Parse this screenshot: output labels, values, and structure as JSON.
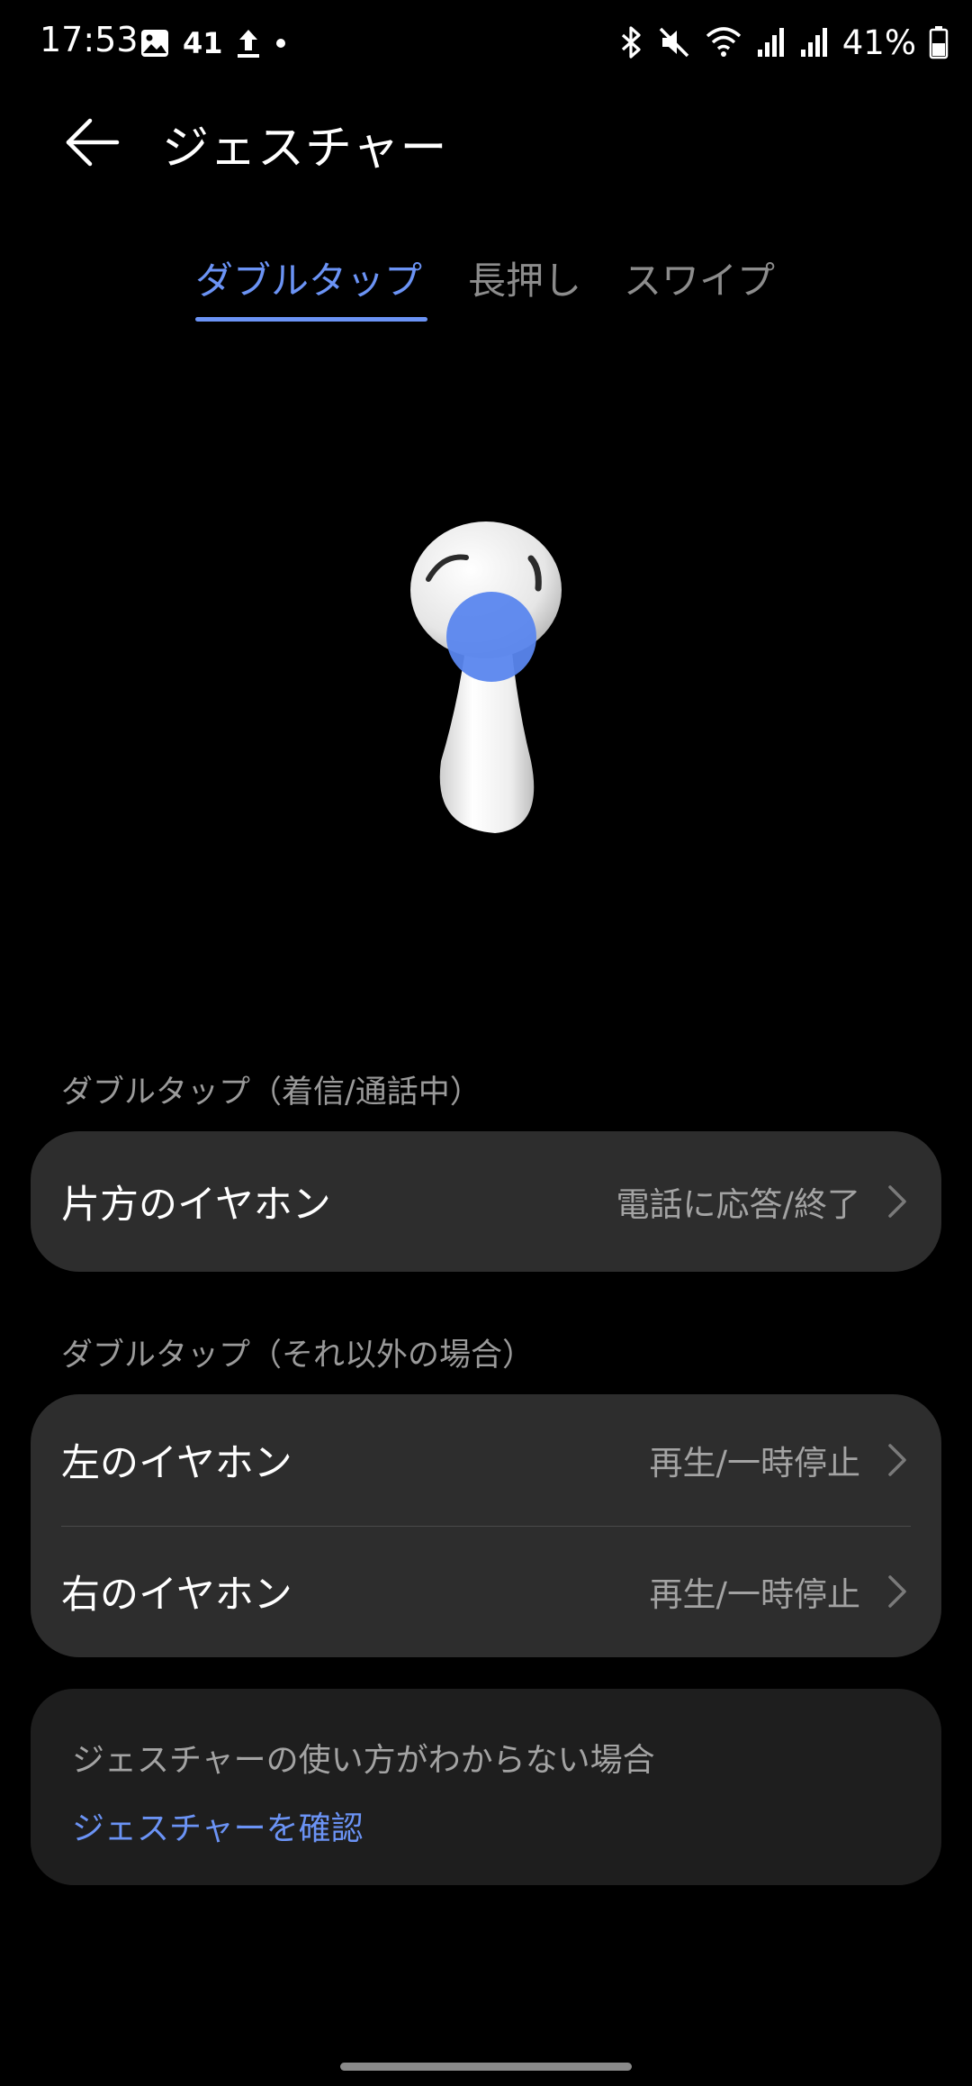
{
  "status_bar": {
    "time": "17:53",
    "notification_count": "41",
    "battery": "41%"
  },
  "header": {
    "title": "ジェスチャー"
  },
  "tabs": [
    {
      "label": "ダブルタップ",
      "active": true
    },
    {
      "label": "長押し",
      "active": false
    },
    {
      "label": "スワイプ",
      "active": false
    }
  ],
  "sections": [
    {
      "label": "ダブルタップ（着信/通話中）",
      "rows": [
        {
          "label": "片方のイヤホン",
          "value": "電話に応答/終了"
        }
      ]
    },
    {
      "label": "ダブルタップ（それ以外の場合）",
      "rows": [
        {
          "label": "左のイヤホン",
          "value": "再生/一時停止"
        },
        {
          "label": "右のイヤホン",
          "value": "再生/一時停止"
        }
      ]
    }
  ],
  "help": {
    "text": "ジェスチャーの使い方がわからない場合",
    "link": "ジェスチャーを確認"
  },
  "colors": {
    "accent": "#6b93f5",
    "background": "#000000",
    "card": "#2d2d2d"
  }
}
